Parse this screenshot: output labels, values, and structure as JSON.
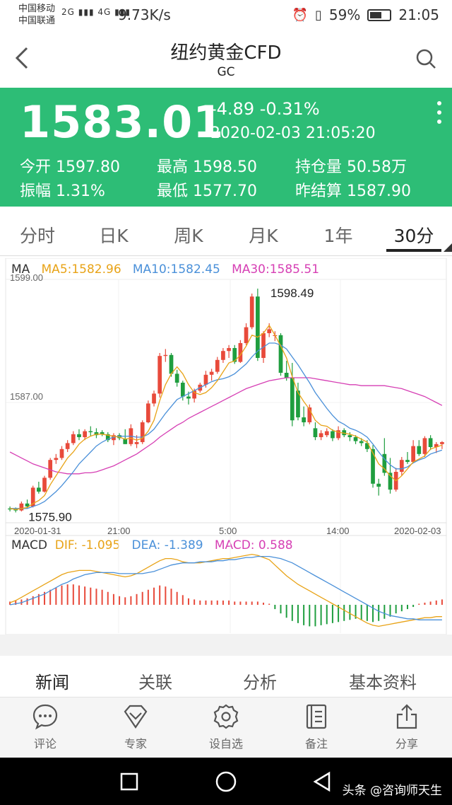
{
  "status_bar": {
    "carrier1": "中国移动",
    "carrier2": "中国联通",
    "net1": "2G",
    "net2": "4G",
    "speed": "9.73K/s",
    "battery": "59%",
    "battery_level": 0.59,
    "time": "21:05"
  },
  "nav": {
    "title": "纽约黄金CFD",
    "subtitle": "GC"
  },
  "quote": {
    "price": "1583.01",
    "change": "-4.89 -0.31%",
    "datetime": "2020-02-03 21:05:20",
    "stats": [
      {
        "label": "今开",
        "value": "1597.80"
      },
      {
        "label": "最高",
        "value": "1598.50"
      },
      {
        "label": "持仓量",
        "value": "50.58万"
      },
      {
        "label": "振幅",
        "value": "1.31%"
      },
      {
        "label": "最低",
        "value": "1577.70"
      },
      {
        "label": "昨结算",
        "value": "1587.90"
      }
    ],
    "bg_color": "#2dbd76"
  },
  "tabs": [
    "分时",
    "日K",
    "周K",
    "月K",
    "1年",
    "30分"
  ],
  "active_tab": "30分",
  "ma_legend": {
    "label": "MA",
    "ma5": "MA5:1582.96",
    "ma10": "MA10:1582.45",
    "ma30": "MA30:1585.51",
    "colors": {
      "ma5": "#e8a317",
      "ma10": "#4a90d9",
      "ma30": "#d63fb4"
    }
  },
  "macd_legend": {
    "label": "MACD",
    "dif": "DIF: -1.095",
    "dea": "DEA: -1.389",
    "macd": "MACD: 0.588"
  },
  "chart_data": {
    "type": "candlestick",
    "y_ticks": [
      "1599.00",
      "1587.00"
    ],
    "ylim": [
      1575,
      1599
    ],
    "x_labels": [
      "2020-01-31",
      "21:00",
      "5:00",
      "14:00",
      "2020-02-03"
    ],
    "high_label": "1598.49",
    "low_label": "1575.90",
    "up_color": "#e84a3b",
    "down_color": "#1f9e3f",
    "candles": [
      [
        1576.3,
        1576.5,
        1576.0,
        1576.2
      ],
      [
        1576.2,
        1576.4,
        1575.9,
        1576.1
      ],
      [
        1576.1,
        1577.0,
        1576.0,
        1576.8
      ],
      [
        1576.8,
        1577.2,
        1576.3,
        1576.5
      ],
      [
        1576.5,
        1578.6,
        1576.4,
        1578.4
      ],
      [
        1578.4,
        1579.0,
        1577.8,
        1578.0
      ],
      [
        1578.0,
        1579.6,
        1577.9,
        1579.4
      ],
      [
        1579.4,
        1581.4,
        1579.2,
        1581.2
      ],
      [
        1581.2,
        1581.8,
        1580.8,
        1581.4
      ],
      [
        1581.4,
        1582.6,
        1581.2,
        1582.3
      ],
      [
        1582.3,
        1583.2,
        1582.0,
        1582.9
      ],
      [
        1582.9,
        1584.1,
        1582.7,
        1583.8
      ],
      [
        1583.8,
        1584.3,
        1583.2,
        1583.5
      ],
      [
        1583.5,
        1584.3,
        1583.2,
        1584.1
      ],
      [
        1584.1,
        1584.6,
        1583.6,
        1584.0
      ],
      [
        1584.0,
        1584.4,
        1583.4,
        1583.7
      ],
      [
        1584.0,
        1584.2,
        1583.6,
        1583.8
      ],
      [
        1583.8,
        1584.0,
        1583.0,
        1583.2
      ],
      [
        1583.2,
        1583.9,
        1582.7,
        1583.7
      ],
      [
        1583.7,
        1583.9,
        1583.2,
        1583.4
      ],
      [
        1583.3,
        1584.3,
        1582.8,
        1582.8
      ],
      [
        1582.8,
        1584.8,
        1582.6,
        1584.4
      ],
      [
        1582.8,
        1583.7,
        1582.4,
        1583.0
      ],
      [
        1583.0,
        1585.2,
        1582.8,
        1585.0
      ],
      [
        1585.0,
        1587.2,
        1584.9,
        1586.9
      ],
      [
        1586.9,
        1588.2,
        1586.6,
        1587.9
      ],
      [
        1587.9,
        1592.0,
        1587.5,
        1591.7
      ],
      [
        1591.7,
        1592.4,
        1591.1,
        1591.8
      ],
      [
        1591.8,
        1592.0,
        1589.6,
        1589.9
      ],
      [
        1589.9,
        1590.3,
        1588.6,
        1589.0
      ],
      [
        1589.0,
        1589.2,
        1587.2,
        1587.6
      ],
      [
        1587.6,
        1588.1,
        1586.8,
        1587.4
      ],
      [
        1587.4,
        1588.4,
        1587.0,
        1588.2
      ],
      [
        1588.2,
        1589.0,
        1588.0,
        1588.8
      ],
      [
        1588.8,
        1590.2,
        1588.5,
        1589.8
      ],
      [
        1589.8,
        1590.4,
        1589.2,
        1590.1
      ],
      [
        1590.1,
        1591.6,
        1589.9,
        1591.3
      ],
      [
        1591.3,
        1592.5,
        1591.0,
        1592.2
      ],
      [
        1592.2,
        1592.8,
        1591.5,
        1592.5
      ],
      [
        1592.5,
        1592.8,
        1590.9,
        1591.1
      ],
      [
        1591.1,
        1593.3,
        1591.0,
        1593.0
      ],
      [
        1593.0,
        1595.0,
        1592.8,
        1594.6
      ],
      [
        1594.6,
        1598.0,
        1594.4,
        1597.7
      ],
      [
        1597.7,
        1598.5,
        1591.2,
        1591.5
      ],
      [
        1591.5,
        1594.2,
        1591.0,
        1594.0
      ],
      [
        1594.0,
        1595.0,
        1593.6,
        1594.4
      ],
      [
        1593.8,
        1594.2,
        1593.2,
        1593.8
      ],
      [
        1593.8,
        1594.0,
        1589.7,
        1590.0
      ],
      [
        1590.0,
        1591.2,
        1589.2,
        1589.5
      ],
      [
        1589.5,
        1591.0,
        1584.6,
        1585.2
      ],
      [
        1588.2,
        1589.0,
        1585.2,
        1585.5
      ],
      [
        1585.5,
        1586.6,
        1584.6,
        1585.0
      ],
      [
        1585.0,
        1586.8,
        1584.8,
        1586.5
      ],
      [
        1584.4,
        1585.0,
        1583.2,
        1583.5
      ],
      [
        1583.5,
        1584.2,
        1583.2,
        1583.9
      ],
      [
        1583.7,
        1584.4,
        1583.5,
        1584.1
      ],
      [
        1584.1,
        1584.3,
        1583.1,
        1583.4
      ],
      [
        1583.4,
        1584.6,
        1583.2,
        1584.2
      ],
      [
        1584.2,
        1584.4,
        1583.5,
        1583.7
      ],
      [
        1583.7,
        1584.0,
        1583.1,
        1583.5
      ],
      [
        1583.5,
        1583.7,
        1582.8,
        1583.1
      ],
      [
        1583.1,
        1583.4,
        1582.6,
        1582.9
      ],
      [
        1582.9,
        1583.2,
        1582.0,
        1582.3
      ],
      [
        1582.3,
        1582.7,
        1578.4,
        1578.8
      ],
      [
        1578.8,
        1579.3,
        1577.6,
        1578.5
      ],
      [
        1581.8,
        1583.4,
        1579.6,
        1579.9
      ],
      [
        1579.9,
        1581.4,
        1577.8,
        1578.2
      ],
      [
        1578.2,
        1580.4,
        1578.0,
        1580.0
      ],
      [
        1580.0,
        1581.5,
        1579.6,
        1581.2
      ],
      [
        1581.2,
        1582.0,
        1580.8,
        1581.0
      ],
      [
        1581.0,
        1583.2,
        1580.9,
        1582.6
      ],
      [
        1582.6,
        1583.2,
        1581.6,
        1581.8
      ],
      [
        1581.8,
        1583.6,
        1581.5,
        1583.4
      ],
      [
        1583.4,
        1583.7,
        1582.2,
        1582.5
      ],
      [
        1582.5,
        1583.0,
        1581.9,
        1582.8
      ],
      [
        1582.8,
        1583.1,
        1582.3,
        1583.0
      ]
    ],
    "ma5": [
      1576.3,
      1576.2,
      1576.3,
      1576.4,
      1576.8,
      1577.1,
      1577.6,
      1578.7,
      1579.6,
      1580.5,
      1581.4,
      1582.0,
      1582.8,
      1583.3,
      1583.6,
      1583.8,
      1583.8,
      1583.7,
      1583.6,
      1583.5,
      1583.3,
      1583.4,
      1583.2,
      1583.4,
      1584.1,
      1585.2,
      1587.2,
      1588.8,
      1589.9,
      1590.6,
      1589.9,
      1588.8,
      1588.0,
      1587.8,
      1588.0,
      1588.5,
      1589.2,
      1590.1,
      1591.0,
      1591.2,
      1591.8,
      1592.7,
      1593.8,
      1593.6,
      1594.0,
      1594.8,
      1593.8,
      1592.7,
      1591.5,
      1589.6,
      1588.0,
      1587.1,
      1586.3,
      1585.2,
      1584.7,
      1584.6,
      1584.2,
      1584.0,
      1583.9,
      1583.8,
      1583.6,
      1583.3,
      1583.0,
      1581.9,
      1580.8,
      1580.3,
      1579.6,
      1579.1,
      1579.6,
      1580.3,
      1581.0,
      1581.3,
      1581.6,
      1582.3,
      1582.5,
      1582.7
    ],
    "ma10": [
      1576.3,
      1576.3,
      1576.3,
      1576.3,
      1576.5,
      1576.7,
      1577.0,
      1577.5,
      1578.0,
      1578.6,
      1579.3,
      1580.0,
      1580.8,
      1581.4,
      1582.0,
      1582.6,
      1583.0,
      1583.3,
      1583.5,
      1583.6,
      1583.6,
      1583.6,
      1583.5,
      1583.5,
      1583.8,
      1584.3,
      1585.1,
      1585.9,
      1586.6,
      1587.3,
      1587.6,
      1587.9,
      1588.2,
      1588.5,
      1588.8,
      1589.1,
      1589.3,
      1589.4,
      1589.6,
      1589.9,
      1590.4,
      1590.9,
      1591.6,
      1592.2,
      1592.6,
      1593.0,
      1593.0,
      1592.8,
      1592.4,
      1591.6,
      1590.8,
      1589.9,
      1589.0,
      1588.0,
      1587.2,
      1586.4,
      1585.7,
      1585.1,
      1584.8,
      1584.4,
      1584.2,
      1583.9,
      1583.5,
      1582.8,
      1582.0,
      1581.3,
      1580.7,
      1580.3,
      1580.3,
      1580.5,
      1580.9,
      1581.2,
      1581.4,
      1581.8,
      1582.0,
      1582.2
    ],
    "ma30": [
      1582.0,
      1581.7,
      1581.4,
      1581.1,
      1580.8,
      1580.6,
      1580.4,
      1580.2,
      1580.0,
      1579.9,
      1579.8,
      1579.8,
      1579.8,
      1579.9,
      1579.9,
      1580.0,
      1580.2,
      1580.4,
      1580.6,
      1580.9,
      1581.2,
      1581.5,
      1581.8,
      1582.2,
      1582.6,
      1583.0,
      1583.5,
      1583.9,
      1584.3,
      1584.7,
      1585.0,
      1585.4,
      1585.7,
      1586.0,
      1586.3,
      1586.6,
      1586.9,
      1587.2,
      1587.5,
      1587.8,
      1588.1,
      1588.4,
      1588.6,
      1588.8,
      1589.0,
      1589.2,
      1589.3,
      1589.4,
      1589.5,
      1589.5,
      1589.5,
      1589.5,
      1589.5,
      1589.4,
      1589.3,
      1589.2,
      1589.1,
      1589.0,
      1588.9,
      1588.8,
      1588.8,
      1588.7,
      1588.7,
      1588.7,
      1588.7,
      1588.7,
      1588.6,
      1588.5,
      1588.4,
      1588.2,
      1588.0,
      1587.8,
      1587.6,
      1587.3,
      1587.0,
      1586.7
    ],
    "macd_bars": [
      0.3,
      0.4,
      0.5,
      0.6,
      0.8,
      1.0,
      1.2,
      1.4,
      1.6,
      1.8,
      1.9,
      1.9,
      1.8,
      1.7,
      1.6,
      1.5,
      1.4,
      1.2,
      1.0,
      0.8,
      0.7,
      0.8,
      1.0,
      1.2,
      1.4,
      1.6,
      1.8,
      1.7,
      1.5,
      1.2,
      0.9,
      0.6,
      0.5,
      0.4,
      0.4,
      0.4,
      0.4,
      0.4,
      0.4,
      0.3,
      0.3,
      0.3,
      0.3,
      0.3,
      0.2,
      0.1,
      -0.4,
      -0.8,
      -1.2,
      -1.5,
      -1.7,
      -1.9,
      -2.0,
      -2.0,
      -1.9,
      -1.8,
      -1.7,
      -1.6,
      -1.5,
      -1.4,
      -1.3,
      -1.4,
      -1.5,
      -1.6,
      -1.5,
      -1.3,
      -1.1,
      -0.8,
      -0.6,
      -0.4,
      -0.2,
      0.1,
      0.2,
      0.3,
      0.4,
      0.5
    ],
    "dif": [
      0.2,
      0.4,
      0.7,
      1.0,
      1.3,
      1.6,
      1.9,
      2.2,
      2.5,
      2.8,
      3.0,
      3.1,
      3.2,
      3.2,
      3.2,
      3.1,
      3.0,
      2.9,
      2.8,
      2.7,
      2.6,
      2.7,
      2.9,
      3.2,
      3.5,
      3.8,
      4.1,
      4.3,
      4.3,
      4.2,
      4.0,
      3.9,
      3.9,
      3.9,
      4.0,
      4.1,
      4.2,
      4.3,
      4.3,
      4.4,
      4.5,
      4.6,
      4.7,
      4.6,
      4.4,
      4.2,
      3.7,
      3.2,
      2.7,
      2.3,
      1.9,
      1.6,
      1.3,
      1.0,
      0.7,
      0.4,
      0.1,
      -0.2,
      -0.5,
      -0.8,
      -1.1,
      -1.4,
      -1.7,
      -1.9,
      -2.0,
      -1.9,
      -1.8,
      -1.7,
      -1.6,
      -1.5,
      -1.4,
      -1.3,
      -1.2,
      -1.2,
      -1.1,
      -1.1
    ],
    "dea": [
      0.0,
      0.1,
      0.2,
      0.4,
      0.6,
      0.8,
      1.0,
      1.3,
      1.6,
      1.9,
      2.1,
      2.4,
      2.6,
      2.8,
      2.9,
      3.0,
      3.0,
      3.0,
      3.0,
      2.9,
      2.9,
      2.9,
      2.9,
      2.9,
      3.0,
      3.1,
      3.3,
      3.5,
      3.7,
      3.8,
      3.9,
      3.9,
      3.9,
      4.0,
      4.0,
      4.0,
      4.1,
      4.1,
      4.2,
      4.2,
      4.3,
      4.4,
      4.4,
      4.5,
      4.5,
      4.5,
      4.4,
      4.3,
      4.1,
      3.9,
      3.6,
      3.3,
      3.0,
      2.7,
      2.4,
      2.1,
      1.8,
      1.5,
      1.2,
      0.9,
      0.6,
      0.3,
      0.0,
      -0.3,
      -0.6,
      -0.8,
      -1.0,
      -1.1,
      -1.2,
      -1.3,
      -1.3,
      -1.4,
      -1.4,
      -1.4,
      -1.4,
      -1.4
    ]
  },
  "sub_tabs": [
    "新闻",
    "关联",
    "分析",
    "基本资料"
  ],
  "active_sub_tab": "新闻",
  "toolbar": [
    {
      "label": "评论",
      "icon": "comment-icon"
    },
    {
      "label": "专家",
      "icon": "diamond-icon"
    },
    {
      "label": "设自选",
      "icon": "gear-icon"
    },
    {
      "label": "备注",
      "icon": "note-icon"
    },
    {
      "label": "分享",
      "icon": "share-icon"
    }
  ],
  "watermark": "头条 @咨询师天生"
}
